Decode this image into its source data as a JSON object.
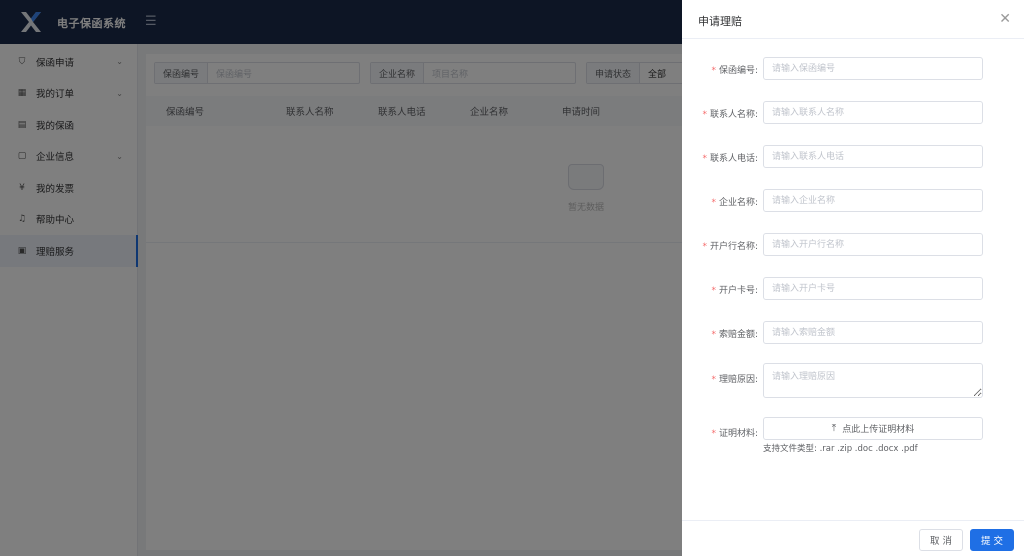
{
  "header": {
    "app_title": "电子保函系统",
    "menu_toggle_icon": "menu-fold-icon"
  },
  "sidebar": {
    "items": [
      {
        "label": "保函申请",
        "icon": "shield-icon",
        "has_chevron": true
      },
      {
        "label": "我的订单",
        "icon": "grid-icon",
        "has_chevron": true
      },
      {
        "label": "我的保函",
        "icon": "document-icon",
        "has_chevron": false
      },
      {
        "label": "企业信息",
        "icon": "file-icon",
        "has_chevron": true
      },
      {
        "label": "我的发票",
        "icon": "yen-icon",
        "has_chevron": false
      },
      {
        "label": "帮助中心",
        "icon": "bell-icon",
        "has_chevron": false
      },
      {
        "label": "理赔服务",
        "icon": "claim-icon",
        "has_chevron": false,
        "active": true
      }
    ]
  },
  "filters": {
    "guarantee_no_label": "保函编号",
    "guarantee_no_placeholder": "保函编号",
    "company_label": "企业名称",
    "company_placeholder": "项目名称",
    "status_label": "申请状态",
    "status_value": "全部"
  },
  "table": {
    "columns": [
      "保函编号",
      "联系人名称",
      "联系人电话",
      "企业名称",
      "申请时间"
    ],
    "empty_text": "暂无数据"
  },
  "drawer": {
    "title": "申请理赔",
    "fields": [
      {
        "label": "保函编号:",
        "placeholder": "请输入保函编号"
      },
      {
        "label": "联系人名称:",
        "placeholder": "请输入联系人名称"
      },
      {
        "label": "联系人电话:",
        "placeholder": "请输入联系人电话"
      },
      {
        "label": "企业名称:",
        "placeholder": "请输入企业名称"
      },
      {
        "label": "开户行名称:",
        "placeholder": "请输入开户行名称"
      },
      {
        "label": "开户卡号:",
        "placeholder": "请输入开户卡号"
      },
      {
        "label": "索赔金额:",
        "placeholder": "请输入索赔金额"
      },
      {
        "label": "理赔原因:",
        "placeholder": "请输入理赔原因"
      }
    ],
    "upload": {
      "label": "证明材料:",
      "button": "点此上传证明材料",
      "tip": "支持文件类型: .rar .zip .doc .docx .pdf"
    },
    "cancel_label": "取 消",
    "submit_label": "提 交"
  },
  "colors": {
    "header_bg": "#1b2a4a",
    "primary": "#1f6fe5",
    "required": "#f56c6c"
  }
}
